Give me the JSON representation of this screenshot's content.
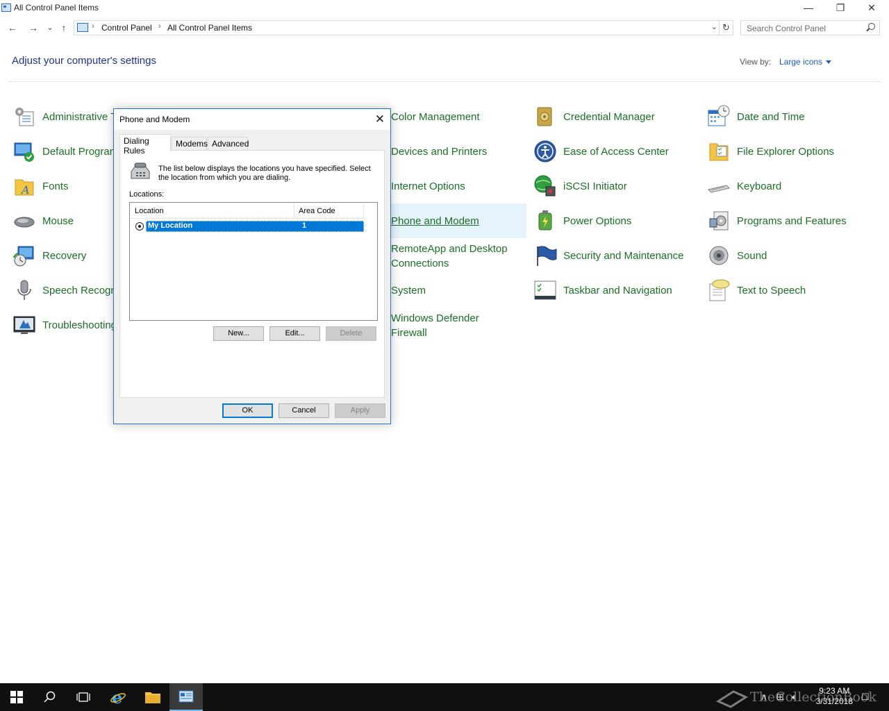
{
  "window": {
    "title": "All Control Panel Items",
    "minimize_glyph": "—",
    "restore_glyph": "❐",
    "close_glyph": "✕"
  },
  "nav": {
    "back_glyph": "←",
    "forward_glyph": "→",
    "recent_glyph": "⌄",
    "up_glyph": "↑",
    "breadcrumbs": [
      "Control Panel",
      "All Control Panel Items"
    ],
    "crumb_sep": "›",
    "dropdown_glyph": "⌄",
    "refresh_glyph": "↻",
    "search_placeholder": "Search Control Panel"
  },
  "header": {
    "title": "Adjust your computer's settings",
    "view_by_label": "View by:",
    "view_by_value": "Large icons"
  },
  "items": {
    "administrative": "Administrative Tools",
    "default_programs": "Default Programs",
    "fonts": "Fonts",
    "mouse": "Mouse",
    "recovery": "Recovery",
    "speech": "Speech Recognition",
    "troubleshooting": "Troubleshooting",
    "color_management": "Color Management",
    "devices_printers": "Devices and Printers",
    "internet_options": "Internet Options",
    "phone_modem": "Phone and Modem",
    "remoteapp_1": "RemoteApp and Desktop",
    "remoteapp_2": "Connections",
    "system": "System",
    "defender_1": "Windows Defender",
    "defender_2": "Firewall",
    "credential_manager": "Credential Manager",
    "ease_of_access": "Ease of Access Center",
    "iscsi": "iSCSI Initiator",
    "power_options": "Power Options",
    "security_maintenance": "Security and Maintenance",
    "taskbar_navigation": "Taskbar and Navigation",
    "date_time": "Date and Time",
    "file_explorer_options": "File Explorer Options",
    "keyboard": "Keyboard",
    "programs_features": "Programs and Features",
    "sound": "Sound",
    "text_to_speech": "Text to Speech"
  },
  "dialog": {
    "title": "Phone and Modem",
    "close_glyph": "✕",
    "tabs": [
      "Dialing Rules",
      "Modems",
      "Advanced"
    ],
    "info_text": "The list below displays the locations you have specified. Select the location from which you are dialing.",
    "locations_label": "Locations:",
    "columns": [
      "Location",
      "Area Code"
    ],
    "rows": [
      {
        "location": "My Location",
        "area_code": "1"
      }
    ],
    "buttons": {
      "new": "New...",
      "edit": "Edit...",
      "delete": "Delete",
      "ok": "OK",
      "cancel": "Cancel",
      "apply": "Apply"
    }
  },
  "taskbar": {
    "time": "9:23 AM",
    "date": "3/31/2018",
    "watermark": "TheCollectionBook",
    "tray_up_glyph": "∧",
    "tray_network_glyph": "⊞",
    "tray_volume_glyph": "🔈︎",
    "tray_notify_glyph": "☐"
  },
  "colors": {
    "accent": "#0078d7",
    "link_green": "#1b6e26",
    "heading_blue": "#1e3287",
    "taskbar": "#101010"
  }
}
